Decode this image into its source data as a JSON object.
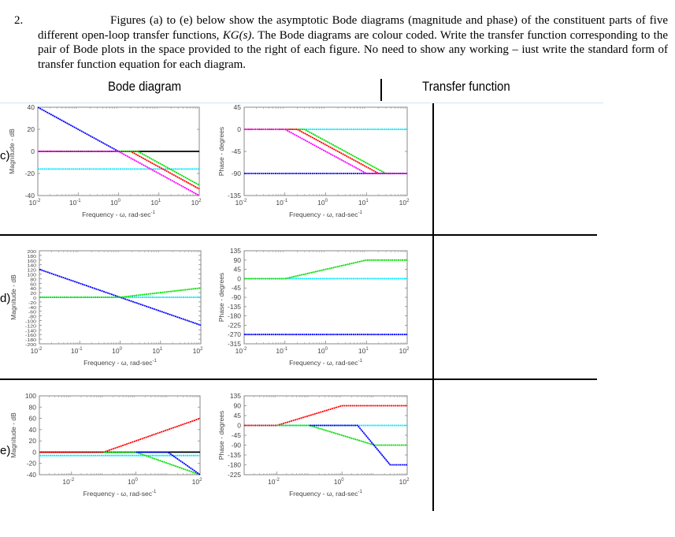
{
  "question": {
    "number": "2.",
    "text": "Figures (a) to (e) below show the asymptotic Bode diagrams (magnitude and phase) of the constituent parts of five different open-loop transfer functions, KG(s). The Bode diagrams are colour coded. Write the transfer function corresponding to the pair of Bode plots in the space provided to the right of each figure. No need to show any working – just write the standard form of transfer function equation for each diagram.",
    "text_before": "Figures (a) to (e) below show the asymptotic Bode diagrams (magnitude and phase) of the constituent parts of five different open-loop transfer functions, ",
    "math": "KG(s)",
    "text_after": ". The Bode diagrams are colour coded. Write the transfer function corresponding to the pair of Bode plots in the space provided to the right of each figure. No need to show any working – iust write the standard form of transfer function equation for each diagram."
  },
  "table": {
    "col1_header": "Bode diagram",
    "col2_header": "Transfer function",
    "rows": [
      {
        "label": "c)",
        "answer": ""
      },
      {
        "label": "d)",
        "answer": ""
      },
      {
        "label": "e)",
        "answer": ""
      }
    ]
  },
  "chart_data": [
    {
      "id": "c-mag",
      "type": "line",
      "scale_x": "log",
      "xlabel": "Frequency - ω, rad-sec-1",
      "ylabel": "Magnitude - dB",
      "xlim": [
        0.01,
        100
      ],
      "ylim": [
        -40,
        40
      ],
      "xticks": [
        "10^-2",
        "10^-1",
        "10^0",
        "10^1",
        "10^2"
      ],
      "yticks": [
        -40,
        -20,
        0,
        20,
        40
      ],
      "series": [
        {
          "name": "black",
          "color": "#000000",
          "points": [
            [
              0.01,
              0
            ],
            [
              100,
              0
            ]
          ]
        },
        {
          "name": "blue",
          "color": "#0000ff",
          "points": [
            [
              0.01,
              40
            ],
            [
              1,
              0
            ]
          ]
        },
        {
          "name": "cyan",
          "color": "#00e5ff",
          "points": [
            [
              0.01,
              -16
            ],
            [
              100,
              -16
            ]
          ]
        },
        {
          "name": "red",
          "color": "#ff0000",
          "points": [
            [
              0.01,
              0
            ],
            [
              2,
              0
            ],
            [
              100,
              -34
            ]
          ]
        },
        {
          "name": "green",
          "color": "#00e000",
          "points": [
            [
              0.01,
              0
            ],
            [
              3,
              0
            ],
            [
              100,
              -30.5
            ]
          ]
        },
        {
          "name": "magenta",
          "color": "#ff00ff",
          "points": [
            [
              0.01,
              0
            ],
            [
              1,
              0
            ],
            [
              100,
              -40
            ]
          ]
        }
      ]
    },
    {
      "id": "c-phase",
      "type": "line",
      "scale_x": "log",
      "xlabel": "Frequency - ω, rad-sec-1",
      "ylabel": "Phase - degrees",
      "xlim": [
        0.01,
        100
      ],
      "ylim": [
        -135,
        45
      ],
      "xticks": [
        "10^-2",
        "10^-1",
        "10^0",
        "10^1",
        "10^2"
      ],
      "yticks": [
        -135,
        -90,
        -45,
        0,
        45
      ],
      "series": [
        {
          "name": "cyan",
          "color": "#00e5ff",
          "points": [
            [
              0.01,
              0
            ],
            [
              100,
              0
            ]
          ]
        },
        {
          "name": "blue",
          "color": "#0000ff",
          "points": [
            [
              0.01,
              -90
            ],
            [
              100,
              -90
            ]
          ]
        },
        {
          "name": "green",
          "color": "#00e000",
          "points": [
            [
              0.01,
              0
            ],
            [
              0.3,
              0
            ],
            [
              30,
              -90
            ],
            [
              100,
              -90
            ]
          ]
        },
        {
          "name": "red",
          "color": "#ff0000",
          "points": [
            [
              0.01,
              0
            ],
            [
              0.2,
              0
            ],
            [
              20,
              -90
            ],
            [
              100,
              -90
            ]
          ]
        },
        {
          "name": "magenta",
          "color": "#ff00ff",
          "points": [
            [
              0.01,
              0
            ],
            [
              0.1,
              0
            ],
            [
              10,
              -90
            ],
            [
              100,
              -90
            ]
          ]
        }
      ]
    },
    {
      "id": "d-mag",
      "type": "line",
      "scale_x": "log",
      "xlabel": "Frequency - ω, rad-sec-1",
      "ylabel": "Magnitude - dB",
      "xlim": [
        0.01,
        100
      ],
      "ylim": [
        -200,
        200
      ],
      "xticks": [
        "10^-2",
        "10^-1",
        "10^0",
        "10^1",
        "10^2"
      ],
      "yticks": [
        -200,
        -180,
        -160,
        -140,
        -120,
        -100,
        -80,
        -60,
        -40,
        -20,
        0,
        20,
        40,
        60,
        80,
        100,
        120,
        140,
        160,
        180,
        200
      ],
      "series": [
        {
          "name": "cyan",
          "color": "#00e5ff",
          "points": [
            [
              0.01,
              0
            ],
            [
              100,
              0
            ]
          ]
        },
        {
          "name": "blue",
          "color": "#0000ff",
          "points": [
            [
              0.01,
              120
            ],
            [
              100,
              -120
            ]
          ]
        },
        {
          "name": "green",
          "color": "#00e000",
          "points": [
            [
              0.01,
              0
            ],
            [
              1,
              0
            ],
            [
              100,
              40
            ]
          ]
        }
      ]
    },
    {
      "id": "d-phase",
      "type": "line",
      "scale_x": "log",
      "xlabel": "Frequency - ω, rad-sec-1",
      "ylabel": "Phase - degrees",
      "xlim": [
        0.01,
        100
      ],
      "ylim": [
        -315,
        135
      ],
      "xticks": [
        "10^-2",
        "10^-1",
        "10^0",
        "10^1",
        "10^2"
      ],
      "yticks": [
        -315,
        -270,
        -225,
        -180,
        -135,
        -90,
        -45,
        0,
        45,
        90,
        135
      ],
      "series": [
        {
          "name": "cyan",
          "color": "#00e5ff",
          "points": [
            [
              0.01,
              0
            ],
            [
              100,
              0
            ]
          ]
        },
        {
          "name": "green",
          "color": "#00e000",
          "points": [
            [
              0.01,
              0
            ],
            [
              0.1,
              0
            ],
            [
              10,
              90
            ],
            [
              100,
              90
            ]
          ]
        },
        {
          "name": "blue",
          "color": "#0000ff",
          "points": [
            [
              0.01,
              -270
            ],
            [
              100,
              -270
            ]
          ]
        }
      ]
    },
    {
      "id": "e-mag",
      "type": "line",
      "scale_x": "log",
      "xlabel": "Frequency - ω, rad-sec-1",
      "ylabel": "Magnitude - dB",
      "xlim": [
        0.001,
        100
      ],
      "ylim": [
        -40,
        100
      ],
      "xticks": [
        "10^-2",
        "10^0",
        "10^2"
      ],
      "yticks": [
        -40,
        -20,
        0,
        20,
        40,
        60,
        80,
        100
      ],
      "series": [
        {
          "name": "black",
          "color": "#000000",
          "points": [
            [
              0.001,
              0
            ],
            [
              100,
              0
            ]
          ]
        },
        {
          "name": "cyan",
          "color": "#00e5ff",
          "points": [
            [
              0.001,
              -6
            ],
            [
              100,
              -6
            ]
          ]
        },
        {
          "name": "red",
          "color": "#ff0000",
          "points": [
            [
              0.001,
              0
            ],
            [
              0.1,
              0
            ],
            [
              100,
              60
            ]
          ]
        },
        {
          "name": "green",
          "color": "#00e000",
          "points": [
            [
              0.1,
              0
            ],
            [
              1,
              0
            ],
            [
              100,
              -40
            ]
          ]
        },
        {
          "name": "blue",
          "color": "#0000ff",
          "points": [
            [
              1,
              0
            ],
            [
              10,
              0
            ],
            [
              100,
              -40
            ]
          ]
        }
      ]
    },
    {
      "id": "e-phase",
      "type": "line",
      "scale_x": "log",
      "xlabel": "Frequency - ω, rad-sec-1",
      "ylabel": "Phase - degrees",
      "xlim": [
        0.001,
        100
      ],
      "ylim": [
        -225,
        135
      ],
      "xticks": [
        "10^-2",
        "10^0",
        "10^2"
      ],
      "yticks": [
        -225,
        -180,
        -135,
        -90,
        -45,
        0,
        45,
        90,
        135
      ],
      "series": [
        {
          "name": "cyan",
          "color": "#00e5ff",
          "points": [
            [
              0.001,
              0
            ],
            [
              100,
              0
            ]
          ]
        },
        {
          "name": "red",
          "color": "#ff0000",
          "points": [
            [
              0.001,
              0
            ],
            [
              0.01,
              0
            ],
            [
              1,
              90
            ],
            [
              100,
              90
            ]
          ]
        },
        {
          "name": "green",
          "color": "#00e000",
          "points": [
            [
              0.01,
              0
            ],
            [
              0.1,
              0
            ],
            [
              10,
              -90
            ],
            [
              100,
              -90
            ]
          ]
        },
        {
          "name": "blue",
          "color": "#0000ff",
          "points": [
            [
              0.1,
              0
            ],
            [
              3,
              0
            ],
            [
              30,
              -180
            ],
            [
              100,
              -180
            ]
          ]
        }
      ]
    }
  ]
}
